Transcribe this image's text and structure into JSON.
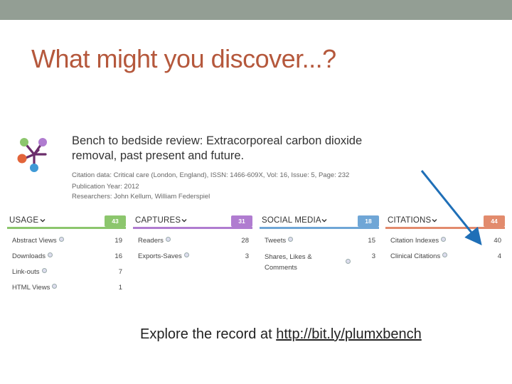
{
  "slide": {
    "title": "What might you discover...?",
    "footer_prefix": "Explore the record at ",
    "footer_link": "http://bit.ly/plumxbench"
  },
  "article": {
    "title": "Bench to bedside review: Extracorporeal carbon dioxide removal, past present and future.",
    "citation": "Citation data: Critical care (London, England), ISSN: 1466-609X, Vol: 16, Issue: 5, Page: 232",
    "year": "Publication Year: 2012",
    "researchers": "Researchers: John Kellum, William Federspiel"
  },
  "categories": {
    "usage": {
      "name": "USAGE",
      "total": "43",
      "color": "#8cc66d",
      "rows": [
        {
          "label": "Abstract Views",
          "value": "19"
        },
        {
          "label": "Downloads",
          "value": "16"
        },
        {
          "label": "Link-outs",
          "value": "7"
        },
        {
          "label": "HTML Views",
          "value": "1"
        }
      ]
    },
    "captures": {
      "name": "CAPTURES",
      "total": "31",
      "color": "#b07cd0",
      "rows": [
        {
          "label": "Readers",
          "value": "28"
        },
        {
          "label": "Exports-Saves",
          "value": "3"
        }
      ]
    },
    "social": {
      "name": "SOCIAL MEDIA",
      "total": "18",
      "color": "#6fa6d6",
      "rows": [
        {
          "label": "Tweets",
          "value": "15"
        },
        {
          "label": "Shares, Likes &",
          "label2": "Comments",
          "value": "3"
        }
      ]
    },
    "citations": {
      "name": "CITATIONS",
      "total": "44",
      "color": "#e28b6d",
      "rows": [
        {
          "label": "Citation Indexes",
          "value": "40"
        },
        {
          "label": "Clinical Citations",
          "value": "4"
        }
      ]
    }
  },
  "colors": {
    "top_bar": "#939e94",
    "title": "#b5583c",
    "arrow": "#1f6fb7"
  },
  "icons": {
    "logo": "plumx-logo-icon",
    "info": "info-icon",
    "chevron": "chevron-down-icon"
  }
}
